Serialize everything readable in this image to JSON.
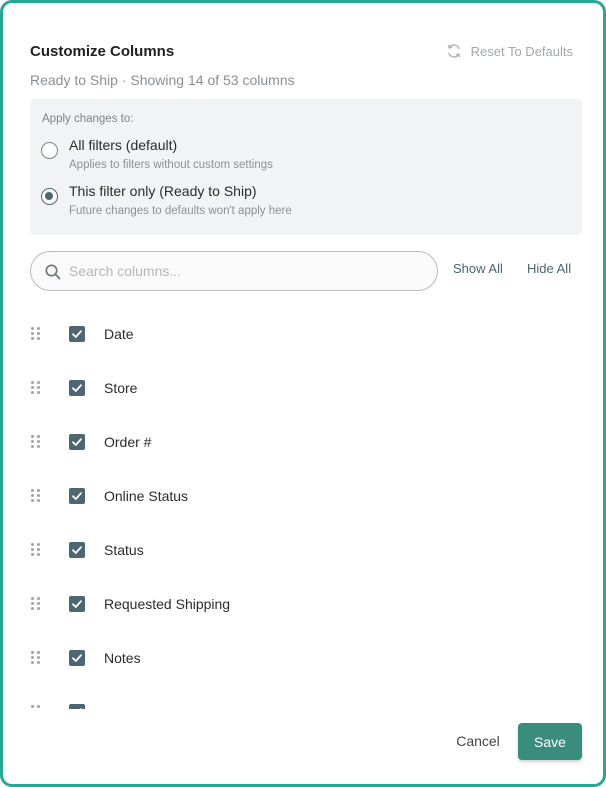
{
  "dialog": {
    "title": "Customize Columns",
    "reset_label": "Reset To Defaults",
    "subtitle": "Ready to Ship · Showing 14 of 53 columns"
  },
  "apply": {
    "label": "Apply changes to:",
    "options": [
      {
        "title": "All filters (default)",
        "desc": "Applies to filters without custom settings",
        "checked": false
      },
      {
        "title": "This filter only (Ready to Ship)",
        "desc": "Future changes to defaults won't apply here",
        "checked": true
      }
    ]
  },
  "search": {
    "placeholder": "Search columns..."
  },
  "actions": {
    "show_all": "Show All",
    "hide_all": "Hide All"
  },
  "columns": [
    {
      "label": "Date",
      "checked": true
    },
    {
      "label": "Store",
      "checked": true
    },
    {
      "label": "Order #",
      "checked": true
    },
    {
      "label": "Online Status",
      "checked": true
    },
    {
      "label": "Status",
      "checked": true
    },
    {
      "label": "Requested Shipping",
      "checked": true
    },
    {
      "label": "Notes",
      "checked": true
    },
    {
      "label": "",
      "checked": true
    }
  ],
  "footer": {
    "cancel": "Cancel",
    "save": "Save"
  },
  "colors": {
    "accent": "#3a8c7c",
    "border": "#26a994",
    "checkbox": "#4e6672"
  },
  "icons": {
    "reset": "refresh-icon",
    "search": "search-icon",
    "drag": "drag-handle-icon",
    "check": "check-icon"
  }
}
